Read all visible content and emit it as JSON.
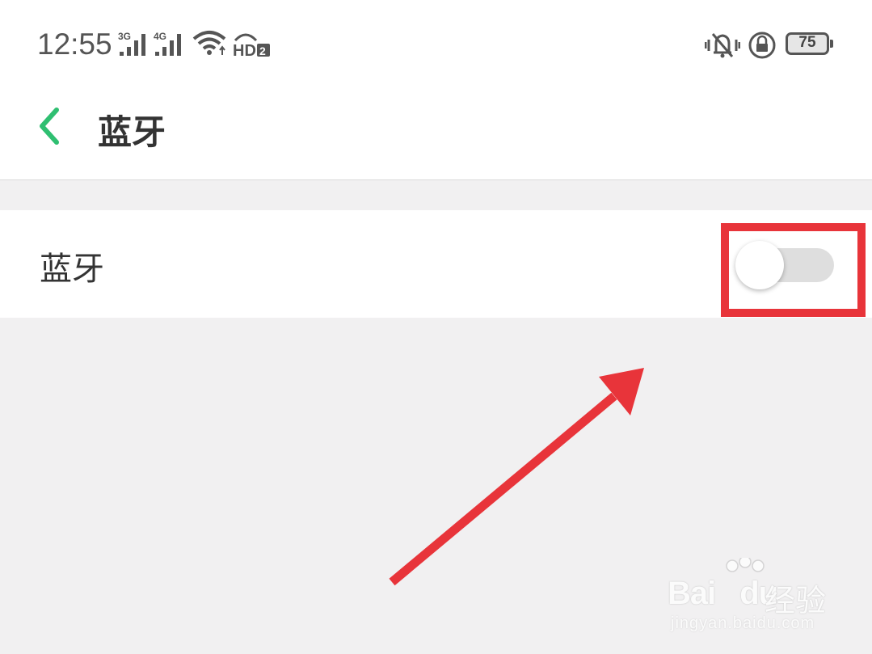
{
  "status_bar": {
    "time": "12:55",
    "signal_1_type": "3G",
    "signal_2_type": "4G",
    "hd_label": "HD",
    "hd_badge": "2",
    "battery_level": "75",
    "icons": [
      "signal-icon",
      "signal-icon",
      "wifi-icon",
      "hd-voice-icon",
      "vibrate-mute-icon",
      "rotation-lock-icon",
      "battery-icon"
    ]
  },
  "header": {
    "title": "蓝牙",
    "back_icon": "chevron-left-icon",
    "accent_color": "#2fbf71"
  },
  "settings": {
    "bluetooth_label": "蓝牙",
    "bluetooth_enabled": false
  },
  "annotation": {
    "highlight_color": "#e8343a",
    "arrow_color": "#e8343a"
  },
  "watermark": {
    "brand": "Bai",
    "brand_suffix": "du",
    "chinese": "经验",
    "url": "jingyan.baidu.com"
  }
}
